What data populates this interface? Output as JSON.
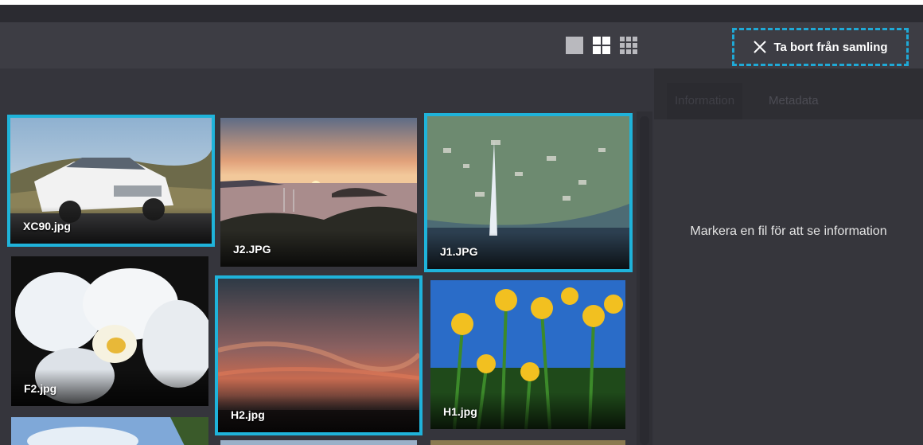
{
  "toolbar": {
    "view_modes": [
      {
        "name": "single",
        "icon": "square-view-icon"
      },
      {
        "name": "large-grid",
        "icon": "grid-2x2-icon"
      },
      {
        "name": "small-grid",
        "icon": "grid-3x3-icon"
      }
    ],
    "remove_label": "Ta bort från samling"
  },
  "grid": {
    "tiles": [
      {
        "name": "XC90.jpg",
        "selected": true
      },
      {
        "name": "J2.JPG",
        "selected": false
      },
      {
        "name": "J1.JPG",
        "selected": true
      },
      {
        "name": "F2.jpg",
        "selected": false
      },
      {
        "name": "H2.jpg",
        "selected": true
      },
      {
        "name": "H1.jpg",
        "selected": false
      }
    ]
  },
  "sidebar": {
    "tabs": [
      "Information",
      "Metadata"
    ],
    "empty_message": "Markera en fil för att se information"
  },
  "colors": {
    "accent": "#1fb3da",
    "background": "#3a3a41"
  }
}
